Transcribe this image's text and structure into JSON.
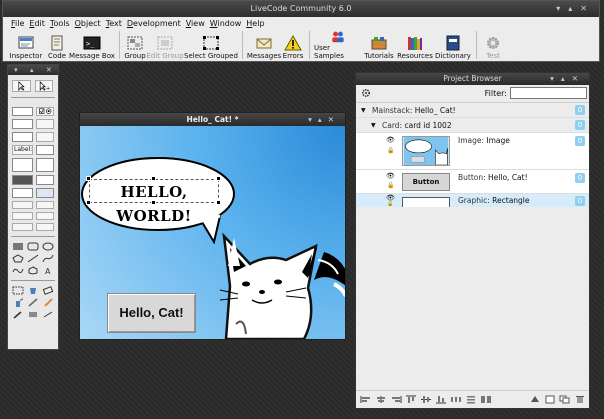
{
  "main_window": {
    "title": "LiveCode Community 6.0",
    "menus": [
      "File",
      "Edit",
      "Tools",
      "Object",
      "Text",
      "Development",
      "View",
      "Window",
      "Help"
    ],
    "toolbar": [
      {
        "label": "Inspector",
        "icon": "inspector-icon",
        "enabled": true
      },
      {
        "label": "Code",
        "icon": "code-icon",
        "enabled": true
      },
      {
        "label": "Message Box",
        "icon": "message-box-icon",
        "enabled": true
      },
      {
        "label": "Group",
        "icon": "group-icon",
        "enabled": true
      },
      {
        "label": "Edit Group",
        "icon": "edit-group-icon",
        "enabled": false
      },
      {
        "label": "Select Grouped",
        "icon": "select-grouped-icon",
        "enabled": true
      },
      {
        "label": "Messages",
        "icon": "messages-icon",
        "enabled": true
      },
      {
        "label": "Errors",
        "icon": "errors-icon",
        "enabled": true
      },
      {
        "label": "User Samples",
        "icon": "user-samples-icon",
        "enabled": true
      },
      {
        "label": "Tutorials",
        "icon": "tutorials-icon",
        "enabled": true
      },
      {
        "label": "Resources",
        "icon": "resources-icon",
        "enabled": true
      },
      {
        "label": "Dictionary",
        "icon": "dictionary-icon",
        "enabled": true
      },
      {
        "label": "Test",
        "icon": "test-icon",
        "enabled": false
      }
    ]
  },
  "tools_palette": {
    "label_tool_text": "Label:"
  },
  "stack_window": {
    "title": "Hello_ Cat! *",
    "speech_text": "HELLO, WORLD!",
    "button_label": "Hello, Cat!"
  },
  "project_browser": {
    "title": "Project Browser",
    "filter_label": "Filter:",
    "filter_value": "",
    "tree": {
      "mainstack_key": "Mainstack:",
      "mainstack_value": "Hello_ Cat!",
      "card_key": "Card:",
      "card_value": "card id 1002",
      "objects": [
        {
          "type_key": "Image:",
          "name": "Image",
          "thumb_text": ""
        },
        {
          "type_key": "Button:",
          "name": "Hello, Cat!",
          "thumb_text": "Button"
        },
        {
          "type_key": "Graphic:",
          "name": "Rectangle",
          "thumb_text": ""
        }
      ],
      "badge_value": "0"
    }
  },
  "colors": {
    "selection_row": "#d6ecfa",
    "badge": "#8fd0f2",
    "card_blue": "#5db3ee"
  }
}
